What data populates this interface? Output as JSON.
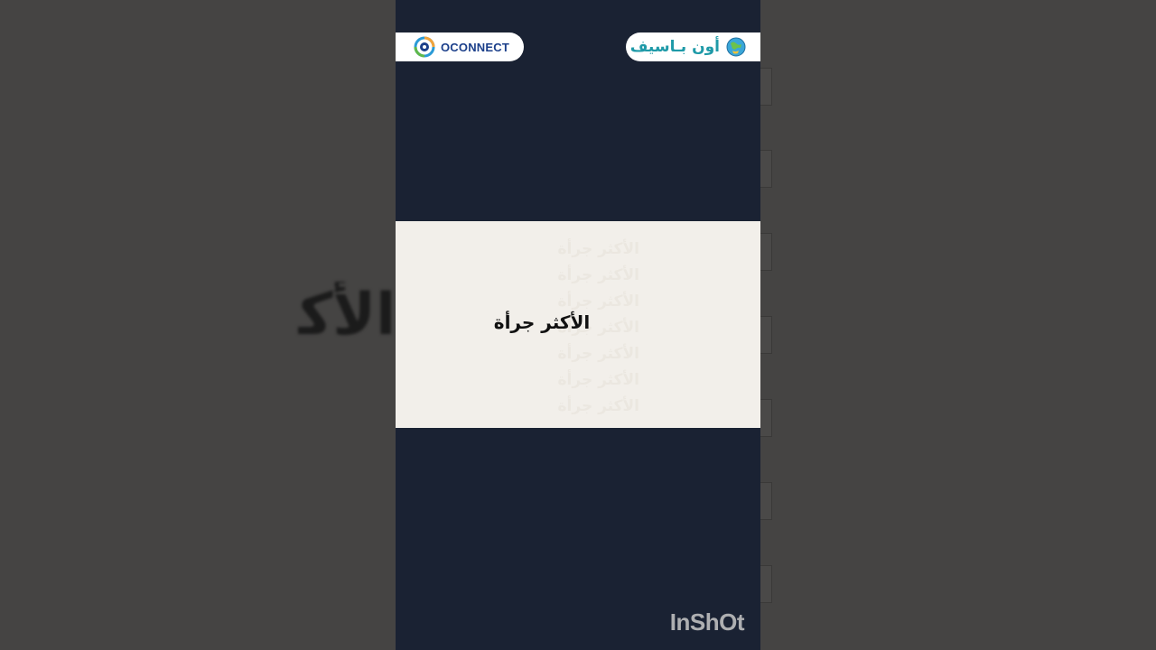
{
  "header": {
    "left_brand": "OCONNECT",
    "right_brand": "أون بـاسيف"
  },
  "panel": {
    "main_text": "الأكثر جرأة",
    "ghost_text": "الأكثر جرأة",
    "ghost_lines": [
      "الأكثر جرأة",
      "الأكثر جرأة",
      "الأكثر جرأة",
      "الأكثر جرأة",
      "الأكثر جرأة",
      "الأكثر جرأة",
      "الأكثر جرأة"
    ]
  },
  "background": {
    "blurred_text": "الأكثر جرأة"
  },
  "watermark": "InShOt",
  "colors": {
    "phone_bg": "#1a2233",
    "panel_bg": "#f2efea",
    "oconnect_blue": "#1b3f8a",
    "onpassive_teal": "#1f9aa8"
  },
  "icons": {
    "left_logo": "oconnect-logo-icon",
    "right_logo": "onpassive-globe-icon"
  }
}
